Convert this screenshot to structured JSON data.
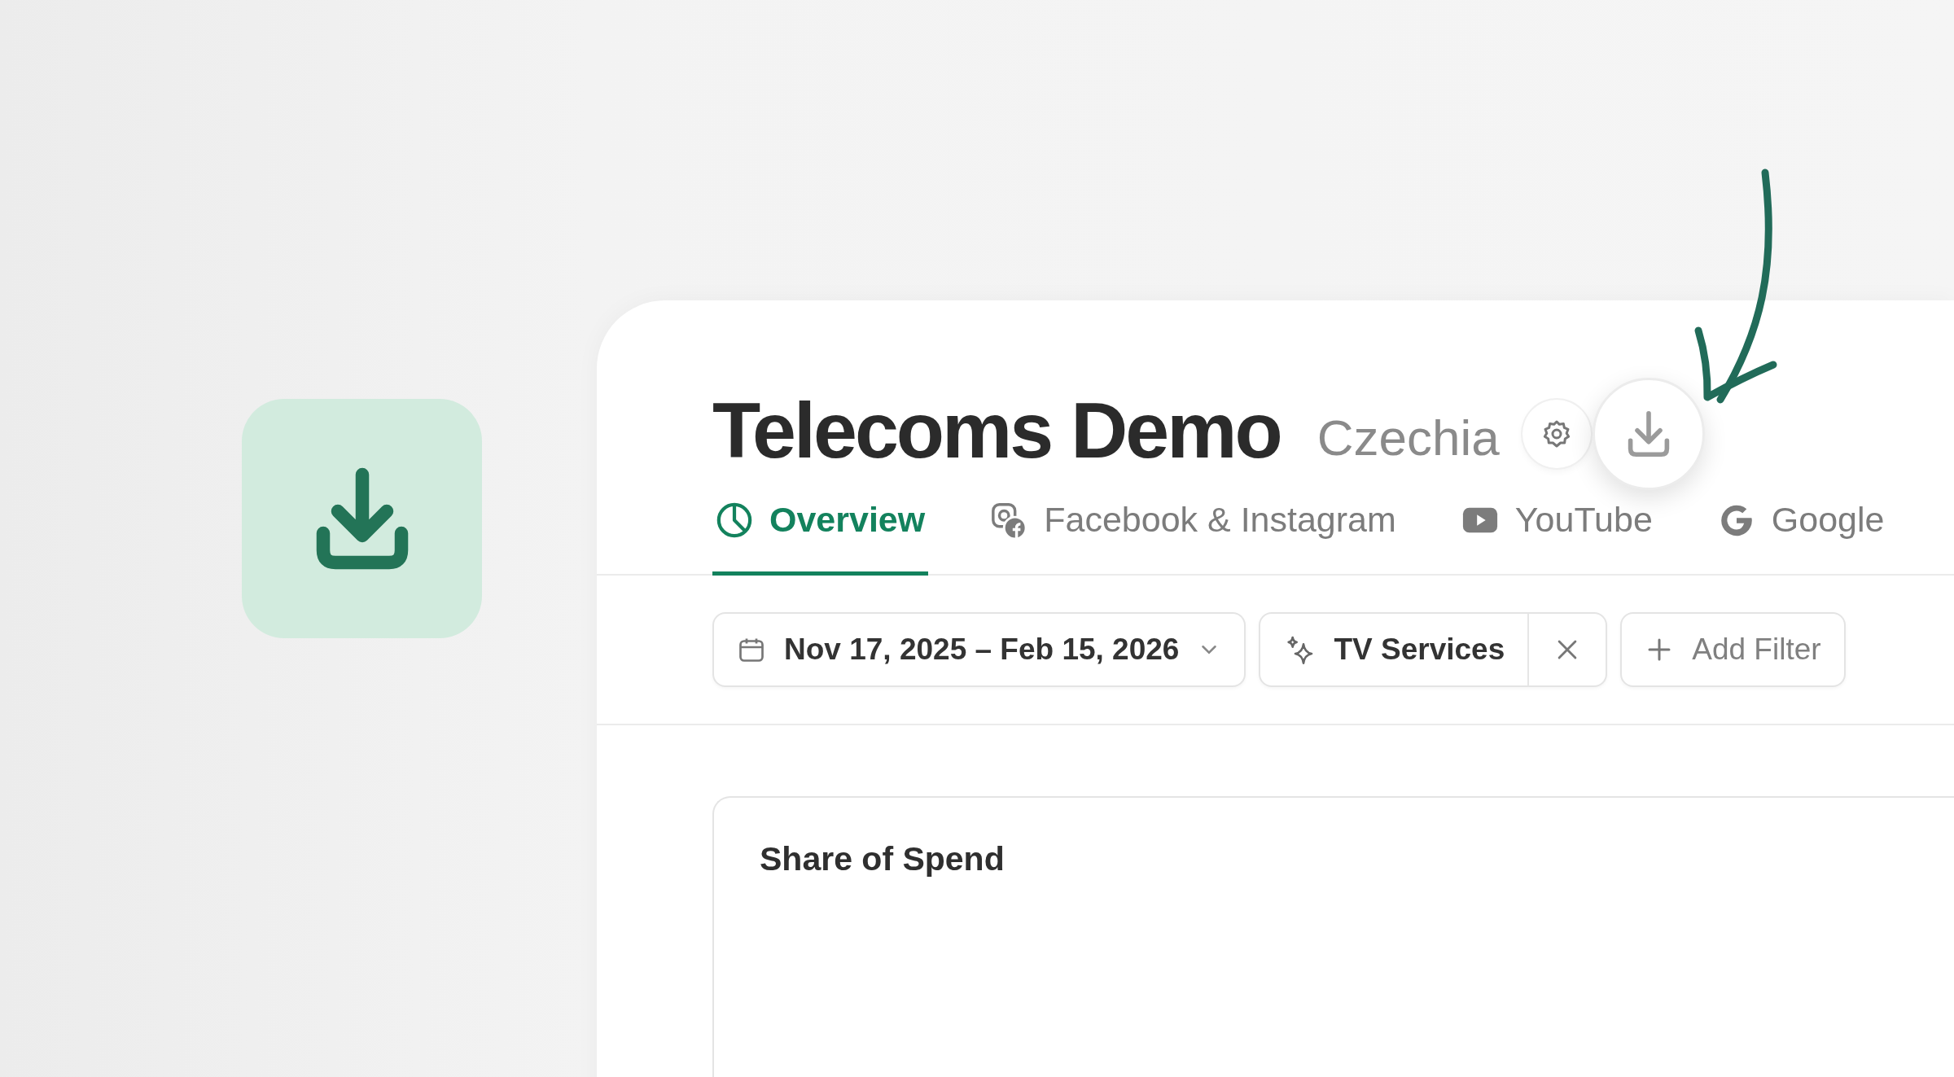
{
  "header": {
    "title": "Telecoms Demo",
    "subtitle": "Czechia"
  },
  "tabs": [
    {
      "label": "Overview",
      "selected": true
    },
    {
      "label": "Facebook & Instagram",
      "selected": false
    },
    {
      "label": "YouTube",
      "selected": false
    },
    {
      "label": "Google",
      "selected": false
    }
  ],
  "filters": {
    "date_range": "Nov 17, 2025 – Feb 15, 2026",
    "active_filter": "TV Services",
    "add_filter": "Add Filter"
  },
  "card": {
    "title": "Share of Spend"
  }
}
